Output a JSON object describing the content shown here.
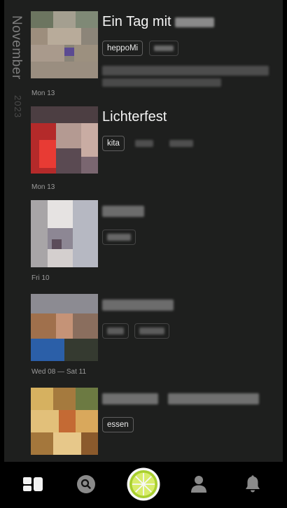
{
  "timeline": {
    "month": "November",
    "year": "2023"
  },
  "entries": [
    {
      "title": "Ein Tag mit",
      "date": "Mon 13",
      "tags": [
        "heppoMi"
      ],
      "thumb": "photo-grey-pixelated"
    },
    {
      "title": "Lichterfest",
      "date": "Mon 13",
      "tags": [
        "kita"
      ],
      "thumb": "photo-red-pixelated"
    },
    {
      "title": "",
      "date": "Fri 10",
      "tags": [],
      "thumb": "photo-light-pixelated"
    },
    {
      "title": "",
      "date": "Wed 08 — Sat 11",
      "tags": [],
      "thumb": "photo-people-pixelated"
    },
    {
      "title": "",
      "date": "",
      "tags": [
        "essen"
      ],
      "thumb": "photo-food-pixelated"
    }
  ],
  "nav": {
    "items": [
      {
        "icon": "feed-grid-icon"
      },
      {
        "icon": "search-icon"
      },
      {
        "icon": "lime-logo-icon"
      },
      {
        "icon": "profile-icon"
      },
      {
        "icon": "bell-icon"
      }
    ]
  },
  "colors": {
    "background": "#1e1f1e",
    "bottom_bar": "#000000",
    "lime_accent": "#c4e23c"
  }
}
